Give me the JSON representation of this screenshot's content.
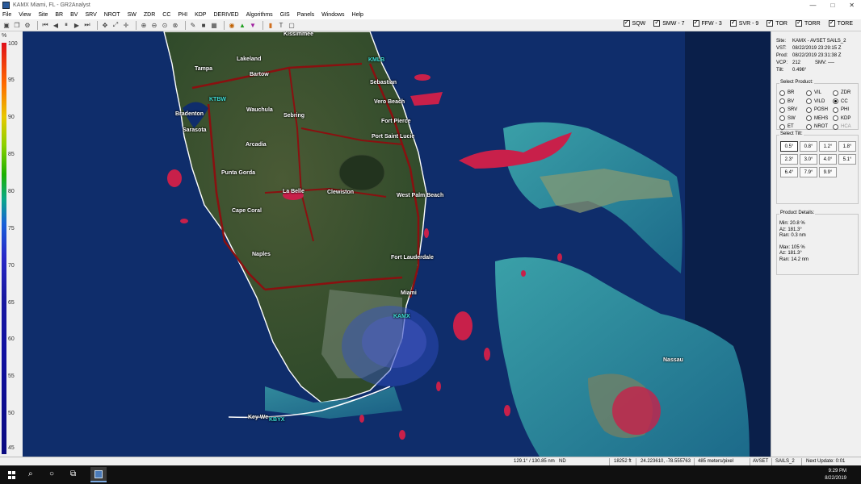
{
  "window": {
    "title": "KAMX Miami, FL - GR2Analyst",
    "min": "—",
    "max": "□",
    "close": "✕"
  },
  "menu": [
    "File",
    "View",
    "Site",
    "BR",
    "BV",
    "SRV",
    "NROT",
    "SW",
    "ZDR",
    "CC",
    "PHI",
    "KDP",
    "DERIVED",
    "Algorithms",
    "GIS",
    "Panels",
    "Windows",
    "Help"
  ],
  "warnings": [
    {
      "label": "SQW",
      "checked": true
    },
    {
      "label": "SMW - 7",
      "checked": true
    },
    {
      "label": "FFW - 3",
      "checked": true
    },
    {
      "label": "SVR - 9",
      "checked": true
    },
    {
      "label": "TOR",
      "checked": true
    },
    {
      "label": "TORR",
      "checked": true
    },
    {
      "label": "TORE",
      "checked": true
    }
  ],
  "scale": {
    "unit": "%",
    "ticks": [
      "100",
      "95",
      "90",
      "85",
      "80",
      "75",
      "70",
      "65",
      "60",
      "55",
      "50",
      "45"
    ]
  },
  "site_info": {
    "site_label": "Site:",
    "site": "KAMX - AVSET SAILS_2",
    "vst_label": "VST:",
    "vst": "08/22/2019 23:29:15 Z",
    "prod_label": "Prod:",
    "prod": "08/22/2019 23:31:38 Z",
    "vcp_label": "VCP:",
    "vcp": "212",
    "smv_label": "SMV:",
    "smv": "----",
    "tilt_label": "Tilt:",
    "tilt": "0.496°"
  },
  "select_product": {
    "title": "Select Product:",
    "options": [
      {
        "label": "BR",
        "selected": false,
        "enabled": true
      },
      {
        "label": "VIL",
        "selected": false,
        "enabled": true
      },
      {
        "label": "ZDR",
        "selected": false,
        "enabled": true
      },
      {
        "label": "BV",
        "selected": false,
        "enabled": true
      },
      {
        "label": "VILD",
        "selected": false,
        "enabled": true
      },
      {
        "label": "CC",
        "selected": true,
        "enabled": true
      },
      {
        "label": "SRV",
        "selected": false,
        "enabled": true
      },
      {
        "label": "POSH",
        "selected": false,
        "enabled": true
      },
      {
        "label": "PHI",
        "selected": false,
        "enabled": true
      },
      {
        "label": "SW",
        "selected": false,
        "enabled": true
      },
      {
        "label": "MEHS",
        "selected": false,
        "enabled": true
      },
      {
        "label": "KDP",
        "selected": false,
        "enabled": true
      },
      {
        "label": "ET",
        "selected": false,
        "enabled": true
      },
      {
        "label": "NROT",
        "selected": false,
        "enabled": true
      },
      {
        "label": "HCA",
        "selected": false,
        "enabled": false
      }
    ]
  },
  "select_tilt": {
    "title": "Select Tilt:",
    "tilts": [
      "0.5°",
      "0.8°",
      "1.2°",
      "1.8°",
      "2.3°",
      "3.0°",
      "4.0°",
      "5.1°",
      "6.4°",
      "7.9°",
      "9.9°"
    ],
    "active": "0.5°"
  },
  "product_details": {
    "title": "Product Details:",
    "min_label": "Min:",
    "min": "20.8 %",
    "min_az_label": "Az:",
    "min_az": "181.3°",
    "min_ran_label": "Ran:",
    "min_ran": "0.3 nm",
    "max_label": "Max:",
    "max": "105 %",
    "max_az_label": "Az:",
    "max_az": "181.3°",
    "max_ran_label": "Ran:",
    "max_ran": "14.2 nm"
  },
  "cities": [
    {
      "name": "Kissimmee",
      "site": false
    },
    {
      "name": "Lakeland",
      "site": false
    },
    {
      "name": "Tampa",
      "site": false
    },
    {
      "name": "KMLB",
      "site": true
    },
    {
      "name": "Bartow",
      "site": false
    },
    {
      "name": "Sebastian",
      "site": false
    },
    {
      "name": "KTBW",
      "site": true
    },
    {
      "name": "Vero Beach",
      "site": false
    },
    {
      "name": "Wauchula",
      "site": false
    },
    {
      "name": "Bradenton",
      "site": false
    },
    {
      "name": "Sebring",
      "site": false
    },
    {
      "name": "Fort Pierce",
      "site": false
    },
    {
      "name": "Sarasota",
      "site": false
    },
    {
      "name": "Arcadia",
      "site": false
    },
    {
      "name": "Port Saint Lucie",
      "site": false
    },
    {
      "name": "Punta Gorda",
      "site": false
    },
    {
      "name": "La Belle",
      "site": false
    },
    {
      "name": "Clewiston",
      "site": false
    },
    {
      "name": "West Palm Beach",
      "site": false
    },
    {
      "name": "Cape Coral",
      "site": false
    },
    {
      "name": "Naples",
      "site": false
    },
    {
      "name": "Fort Lauderdale",
      "site": false
    },
    {
      "name": "Miami",
      "site": false
    },
    {
      "name": "KAMX",
      "site": true
    },
    {
      "name": "Nassau",
      "site": false
    },
    {
      "name": "Key We",
      "site": false
    },
    {
      "name": "KBYX",
      "site": true
    }
  ],
  "status": {
    "azran": "129.1° / 130.85 nm",
    "value": "ND",
    "height": "18252 ft",
    "coords": "24.223610, -78.555763",
    "scale": "485 meters/pixel",
    "mode": "AVSET",
    "sails": "SAILS_2",
    "next_update": "Next Update: 0:01"
  },
  "taskbar": {
    "time": "9:29 PM",
    "date": "8/22/2019"
  }
}
